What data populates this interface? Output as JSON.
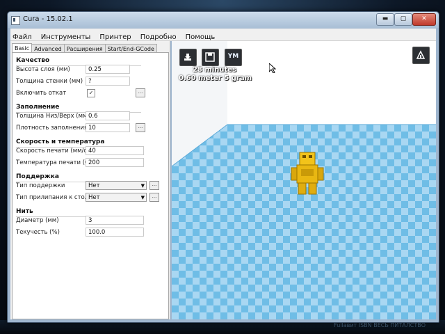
{
  "window": {
    "title": "Cura - 15.02.1",
    "min_label": "▬",
    "max_label": "▢",
    "close_label": "✕"
  },
  "menu": [
    "Файл",
    "Инструменты",
    "Принтер",
    "Подробно",
    "Помощь"
  ],
  "tabs": [
    "Basic",
    "Advanced",
    "Расширения",
    "Start/End-GCode"
  ],
  "sections": {
    "quality": {
      "title": "Качество",
      "layer_height_label": "Высота слоя (мм)",
      "layer_height_value": "0.25",
      "shell_label": "Толщина стенки (мм)",
      "shell_value": "?",
      "retraction_label": "Включить откат",
      "retraction_checked": "✓"
    },
    "fill": {
      "title": "Заполнение",
      "bottom_top_label": "Толщина Низ/Верх (мм)",
      "bottom_top_value": "0.6",
      "density_label": "Плотность заполнения",
      "density_value": "10"
    },
    "speed": {
      "title": "Скорость и температура",
      "print_speed_label": "Скорость печати (мм/с)",
      "print_speed_value": "40",
      "temp_label": "Температура печати (С)",
      "temp_value": "200"
    },
    "support": {
      "title": "Поддержка",
      "support_type_label": "Тип поддержки",
      "support_type_value": "Нет",
      "adhesion_label": "Тип прилипания к столу",
      "adhesion_value": "Нет"
    },
    "filament": {
      "title": "Нить",
      "diameter_label": "Диаметр (мм)",
      "diameter_value": "3",
      "flow_label": "Текучесть (%)",
      "flow_value": "100.0"
    }
  },
  "dots_label": "...",
  "viewport": {
    "print_time": "28 minutes",
    "print_meta": "0.60 meter 5 gram",
    "ym_label": "YM"
  },
  "colors": {
    "plate_light": "#a9d7f2",
    "plate_dark": "#6fbde6",
    "model": "#f2c31a"
  },
  "watermark": "Fullaвит ISBN ВЕСЬ ПИТАЛСТВО"
}
